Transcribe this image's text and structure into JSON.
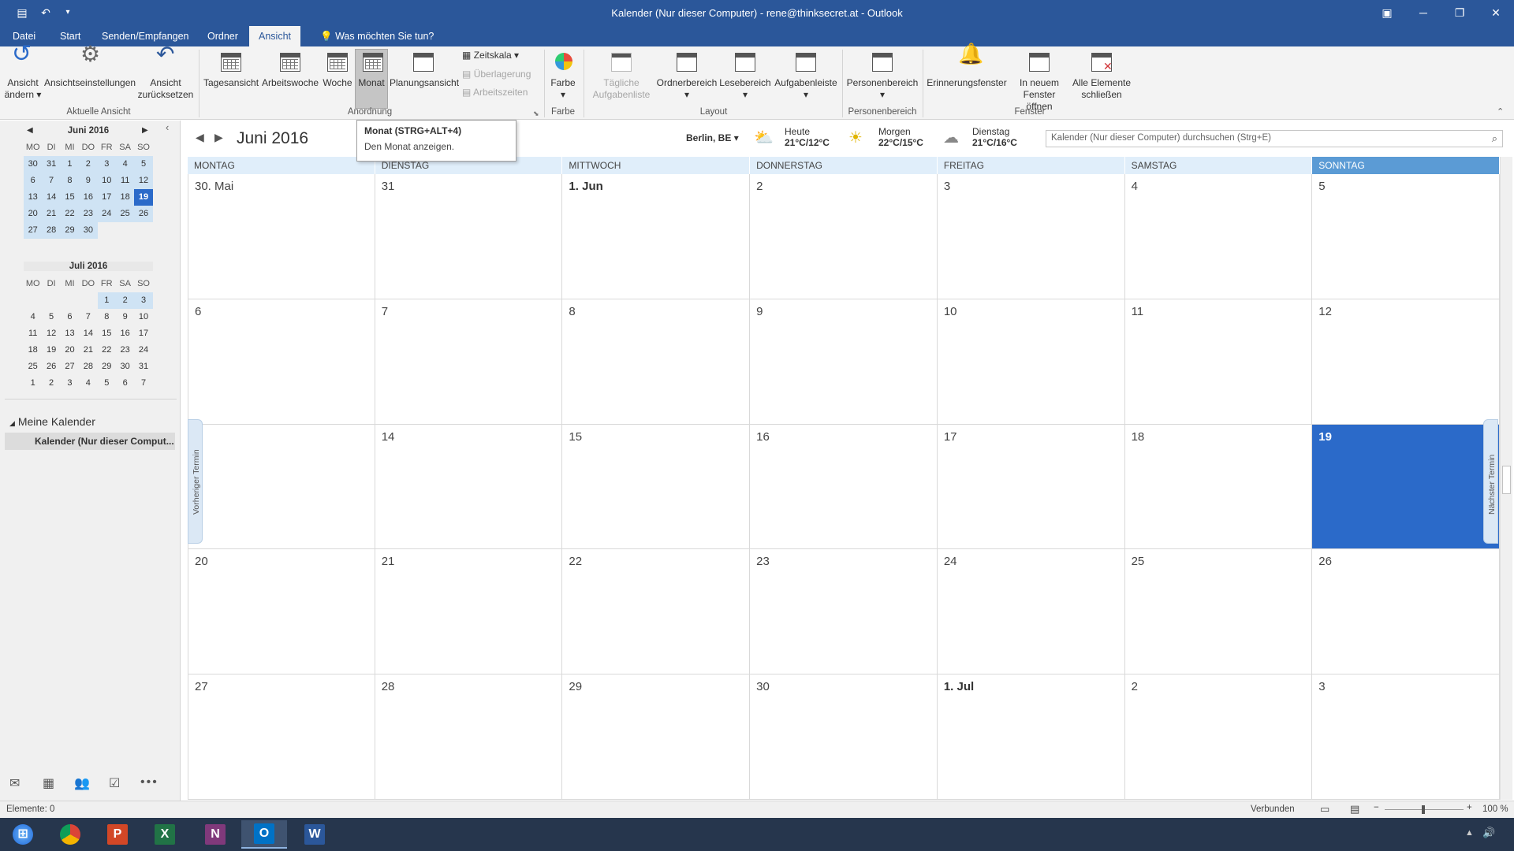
{
  "window": {
    "title": "Kalender (Nur dieser Computer) - rene@thinksecret.at - Outlook"
  },
  "tabs": [
    {
      "label": "Datei"
    },
    {
      "label": "Start"
    },
    {
      "label": "Senden/Empfangen"
    },
    {
      "label": "Ordner"
    },
    {
      "label": "Ansicht"
    },
    {
      "label": "Was möchten Sie tun?"
    }
  ],
  "ribbon": {
    "ansicht_aendern": "Ansicht ändern",
    "ansichtseinstellungen": "Ansichtseinstellungen",
    "ansicht_zuruecksetzen": "Ansicht zurücksetzen",
    "grp_aktuelle": "Aktuelle Ansicht",
    "tagesansicht": "Tagesansicht",
    "arbeitswoche": "Arbeitswoche",
    "woche": "Woche",
    "monat": "Monat",
    "planungsansicht": "Planungsansicht",
    "zeitskala": "Zeitskala",
    "ueberlagerung": "Überlagerung",
    "arbeitszeiten": "Arbeitszeiten",
    "grp_anordnung": "Anordnung",
    "farbe": "Farbe",
    "grp_farbe": "Farbe",
    "taegliche": "Tägliche Aufgabenliste",
    "ordnerbereich": "Ordnerbereich",
    "lesebereich": "Lesebereich",
    "aufgabenleiste": "Aufgabenleiste",
    "grp_layout": "Layout",
    "personenbereich": "Personenbereich",
    "grp_personen": "Personenbereich",
    "erinnerungsfenster": "Erinnerungsfenster",
    "in_neuem": "In neuem Fenster öffnen",
    "alle_schliessen": "Alle Elemente schließen",
    "grp_fenster": "Fenster"
  },
  "tooltip": {
    "title": "Monat (STRG+ALT+4)",
    "desc": "Den Monat anzeigen."
  },
  "mini_cal": {
    "dow": [
      "MO",
      "DI",
      "MI",
      "DO",
      "FR",
      "SA",
      "SO"
    ],
    "june": {
      "title": "Juni 2016",
      "weeks": [
        [
          "30",
          "31",
          "1",
          "2",
          "3",
          "4",
          "5"
        ],
        [
          "6",
          "7",
          "8",
          "9",
          "10",
          "11",
          "12"
        ],
        [
          "13",
          "14",
          "15",
          "16",
          "17",
          "18",
          "19"
        ],
        [
          "20",
          "21",
          "22",
          "23",
          "24",
          "25",
          "26"
        ],
        [
          "27",
          "28",
          "29",
          "30",
          "",
          "",
          ""
        ]
      ]
    },
    "july": {
      "title": "Juli 2016",
      "weeks": [
        [
          "",
          "",
          "",
          "",
          "1",
          "2",
          "3"
        ],
        [
          "4",
          "5",
          "6",
          "7",
          "8",
          "9",
          "10"
        ],
        [
          "11",
          "12",
          "13",
          "14",
          "15",
          "16",
          "17"
        ],
        [
          "18",
          "19",
          "20",
          "21",
          "22",
          "23",
          "24"
        ],
        [
          "25",
          "26",
          "27",
          "28",
          "29",
          "30",
          "31"
        ],
        [
          "1",
          "2",
          "3",
          "4",
          "5",
          "6",
          "7"
        ]
      ]
    }
  },
  "folders": {
    "group": "Meine Kalender",
    "item": "Kalender (Nur dieser Comput..."
  },
  "calendar": {
    "month_title": "Juni 2016",
    "location": "Berlin, BE",
    "weather": [
      {
        "day": "Heute",
        "temp": "21°C/12°C"
      },
      {
        "day": "Morgen",
        "temp": "22°C/15°C"
      },
      {
        "day": "Dienstag",
        "temp": "21°C/16°C"
      }
    ],
    "search_placeholder": "Kalender (Nur dieser Computer) durchsuchen (Strg+E)",
    "weekdays": [
      "MONTAG",
      "DIENSTAG",
      "MITTWOCH",
      "DONNERSTAG",
      "FREITAG",
      "SAMSTAG",
      "SONNTAG"
    ],
    "weeks": [
      [
        "30. Mai",
        "31",
        "1. Jun",
        "2",
        "3",
        "4",
        "5"
      ],
      [
        "6",
        "7",
        "8",
        "9",
        "10",
        "11",
        "12"
      ],
      [
        "",
        "14",
        "15",
        "16",
        "17",
        "18",
        "19"
      ],
      [
        "20",
        "21",
        "22",
        "23",
        "24",
        "25",
        "26"
      ],
      [
        "27",
        "28",
        "29",
        "30",
        "1. Jul",
        "2",
        "3"
      ]
    ],
    "prev_appt": "Vorheriger Termin",
    "next_appt": "Nächster Termin"
  },
  "status": {
    "items": "Elemente: 0",
    "connection": "Verbunden",
    "zoom": "100 %"
  },
  "colors": {
    "accent": "#2b579a",
    "today": "#2b6ac9",
    "header": "#e0eefa"
  }
}
